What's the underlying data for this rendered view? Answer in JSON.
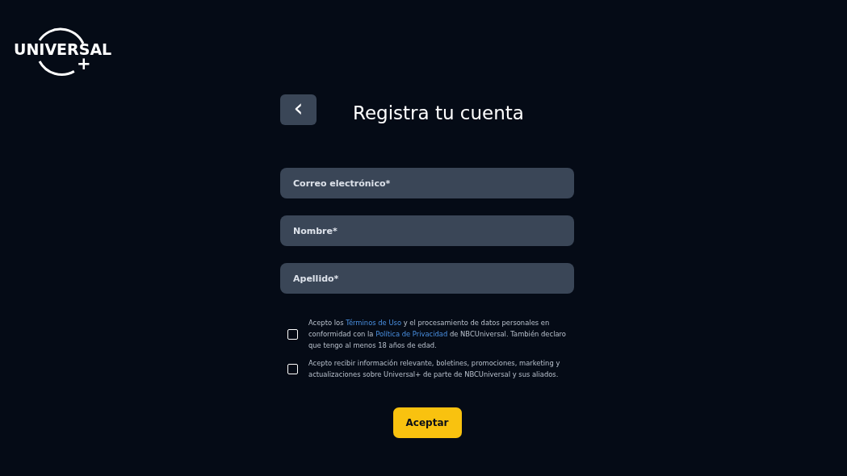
{
  "logo": {
    "wordmark": "UNIVERSAL",
    "plus": "+"
  },
  "back_button": {
    "icon": "‹"
  },
  "title": "Registra tu cuenta",
  "fields": [
    {
      "placeholder": "Correo electrónico*"
    },
    {
      "placeholder": "Nombre*"
    },
    {
      "placeholder": "Apellido*"
    }
  ],
  "consents": [
    {
      "checked": false,
      "parts": [
        {
          "kind": "text",
          "text": "Acepto los"
        },
        {
          "kind": "link",
          "text": "Términos de Uso"
        },
        {
          "kind": "text",
          "text": "y el procesamiento de datos personales en conformidad con la"
        },
        {
          "kind": "link",
          "text": "Política de Privacidad"
        },
        {
          "kind": "text",
          "text": "de NBCUniversal. También declaro que tengo al menos 18 años de edad."
        }
      ]
    },
    {
      "checked": false,
      "parts": [
        {
          "kind": "text",
          "text": "Acepto recibir información relevante, boletines, promociones, marketing y actualizaciones sobre Universal+ de parte de NBCUniversal y sus aliados."
        }
      ]
    }
  ],
  "submit_button": "Aceptar"
}
